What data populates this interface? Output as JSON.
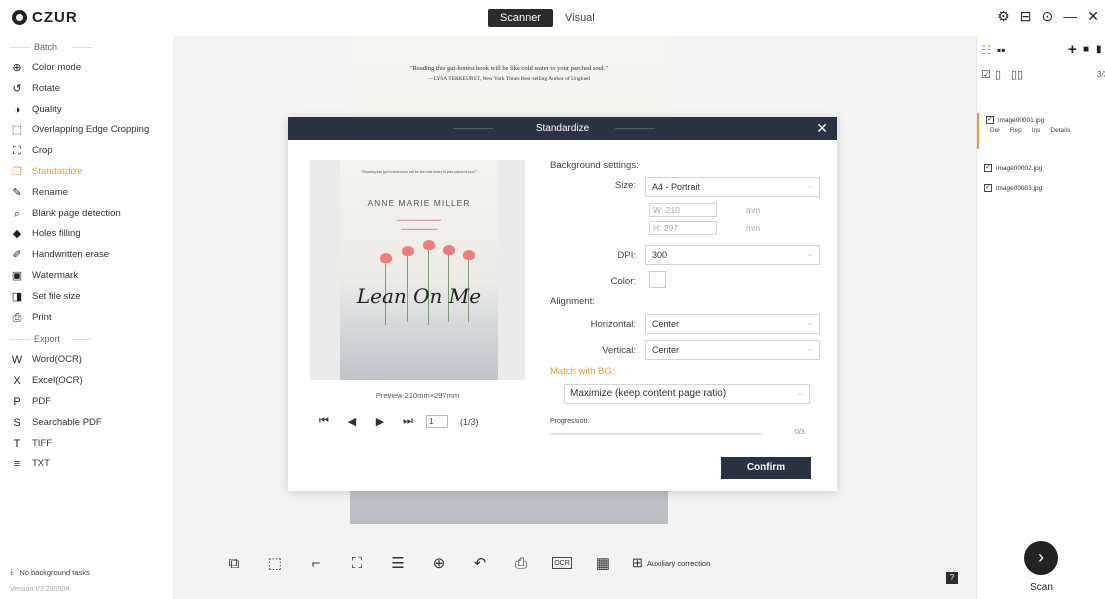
{
  "app": {
    "logo": "CZUR"
  },
  "mode_tabs": [
    "Scanner",
    "Visual"
  ],
  "window_controls": {
    "settings": "⚙",
    "screen": "⊟",
    "help": "⊙",
    "minimize": "—",
    "close": "✕"
  },
  "sidebar": {
    "batch_label": "Batch",
    "batch_items": [
      {
        "icon": "color-mode-icon",
        "glyph": "⊕",
        "label": "Color mode"
      },
      {
        "icon": "rotate-icon",
        "glyph": "↺",
        "label": "Rotate"
      },
      {
        "icon": "quality-icon",
        "glyph": "◑",
        "label": "Quality"
      },
      {
        "icon": "overlap-crop-icon",
        "glyph": "⬚",
        "label": "Overlapping Edge Cropping"
      },
      {
        "icon": "crop-icon",
        "glyph": "⛶",
        "label": "Crop"
      },
      {
        "icon": "standardize-icon",
        "glyph": "❐",
        "label": "Standardize"
      },
      {
        "icon": "rename-icon",
        "glyph": "✎",
        "label": "Rename"
      },
      {
        "icon": "blank-page-icon",
        "glyph": "⌕",
        "label": "Blank page detection"
      },
      {
        "icon": "holes-filling-icon",
        "glyph": "◆",
        "label": "Holes filling"
      },
      {
        "icon": "handwritten-erase-icon",
        "glyph": "✐",
        "label": "Handwritten erase"
      },
      {
        "icon": "watermark-icon",
        "glyph": "▣",
        "label": "Watermark"
      },
      {
        "icon": "file-size-icon",
        "glyph": "◨",
        "label": "Set file size"
      },
      {
        "icon": "print-icon",
        "glyph": "⎙",
        "label": "Print"
      }
    ],
    "export_label": "Export",
    "export_items": [
      {
        "icon": "word-icon",
        "glyph": "W",
        "label": "Word(OCR)"
      },
      {
        "icon": "excel-icon",
        "glyph": "X",
        "label": "Excel(OCR)"
      },
      {
        "icon": "pdf-icon",
        "glyph": "P",
        "label": "PDF"
      },
      {
        "icon": "searchable-pdf-icon",
        "glyph": "S",
        "label": "Searchable PDF"
      },
      {
        "icon": "tiff-icon",
        "glyph": "T",
        "label": "TIFF"
      },
      {
        "icon": "txt-icon",
        "glyph": "≡",
        "label": "TXT"
      }
    ],
    "background_tasks": "No background tasks",
    "version": "Version:V3.230508"
  },
  "main": {
    "book_quote_line1": "\"Reading this gut-honest book will be like cold water to your parched soul.\"",
    "book_quote_line2": "—LYSA TERKEURST, New York Times Best-selling Author of Unglued"
  },
  "toolbar": {
    "aux_label": "Auxiliary correction",
    "ocr_label": "OCR"
  },
  "dialog": {
    "title": "Standardize",
    "preview": {
      "author": "ANNE MARIE MILLER",
      "book_title": "Lean On Me",
      "caption": "Preview  210mm×297mm",
      "page_value": "1",
      "page_count": "(1/3)"
    },
    "background_settings_label": "Background settings:",
    "size_label": "Size:",
    "size_value": "A4 - Portrait",
    "width_label": "W:",
    "width_value": "210",
    "height_label": "H:",
    "height_value": "297",
    "unit": "mm",
    "dpi_label": "DPI:",
    "dpi_value": "300",
    "color_label": "Color:",
    "alignment_label": "Alignment:",
    "horizontal_label": "Horizontal:",
    "horizontal_value": "Center",
    "vertical_label": "Vertical:",
    "vertical_value": "Center",
    "match_bg_label": "Match with BG:",
    "match_value": "Maximize (keep content page ratio)",
    "progression_label": "Progression:",
    "progression_count": "0/3",
    "progression_fraction": 0,
    "confirm_label": "Confirm"
  },
  "rpanel": {
    "count": "3/3",
    "files": [
      {
        "name": "image00001.jpg",
        "selected": true
      },
      {
        "name": "image00002.jpg",
        "selected": false
      },
      {
        "name": "image00003.jpg",
        "selected": false
      }
    ],
    "file_actions": [
      "Del",
      "Rep",
      "Ins",
      "Details"
    ],
    "scan_label": "Scan"
  },
  "colors": {
    "accent": "#f29a38",
    "dialog_header": "#2b3243",
    "dark": "#2b2b2b"
  }
}
